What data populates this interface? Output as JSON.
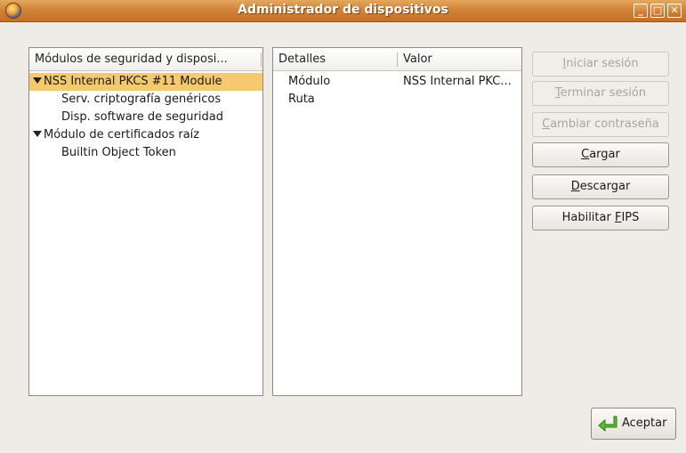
{
  "window": {
    "title": "Administrador de dispositivos"
  },
  "left_panel": {
    "header": "Módulos de seguridad y disposi...",
    "items": [
      {
        "label": "NSS Internal PKCS #11 Module"
      },
      {
        "label": "Serv. criptografía genéricos"
      },
      {
        "label": "Disp. software de seguridad"
      },
      {
        "label": "Módulo de certificados raíz"
      },
      {
        "label": "Builtin Object Token"
      }
    ]
  },
  "details_panel": {
    "col_detail": "Detalles",
    "col_value": "Valor",
    "rows": [
      {
        "detail": "Módulo",
        "value": "NSS Internal PKC..."
      },
      {
        "detail": "Ruta",
        "value": ""
      }
    ]
  },
  "buttons": {
    "login": {
      "pre": "",
      "u": "I",
      "post": "niciar sesión"
    },
    "logout": {
      "pre": "",
      "u": "T",
      "post": "erminar sesión"
    },
    "change_password": {
      "pre": "",
      "u": "C",
      "post": "ambiar contraseña"
    },
    "load": {
      "pre": "",
      "u": "C",
      "post": "argar"
    },
    "unload": {
      "pre": "",
      "u": "D",
      "post": "escargar"
    },
    "fips": {
      "pre": "Habilitar ",
      "u": "F",
      "post": "IPS"
    },
    "ok": "Aceptar"
  },
  "icons": {
    "app": "firefox-icon",
    "ok": "green-arrow-icon"
  },
  "colors": {
    "titlebar": "#d2843a",
    "selection": "#f5c96e"
  }
}
